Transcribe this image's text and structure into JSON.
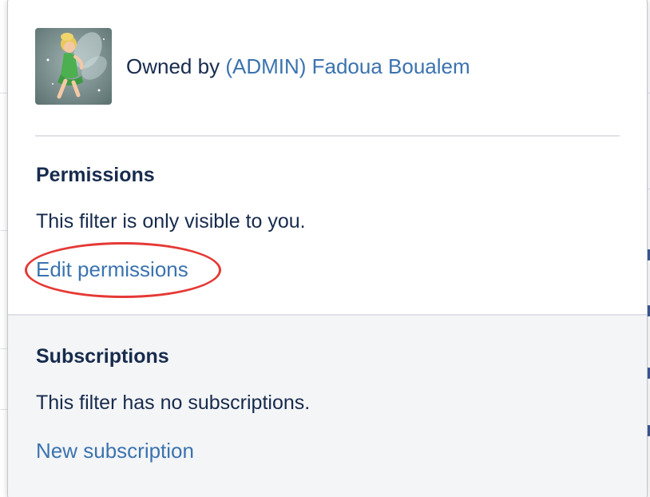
{
  "owner": {
    "prefix": "Owned by",
    "name": "(ADMIN) Fadoua Boualem"
  },
  "permissions": {
    "title": "Permissions",
    "description": "This filter is only visible to you.",
    "edit_link": "Edit permissions"
  },
  "subscriptions": {
    "title": "Subscriptions",
    "description": "This filter has no subscriptions.",
    "new_link": "New subscription"
  },
  "colors": {
    "link": "#3b73af",
    "text": "#172b4d",
    "highlight": "#e53935",
    "section_bg": "#f4f5f7"
  }
}
